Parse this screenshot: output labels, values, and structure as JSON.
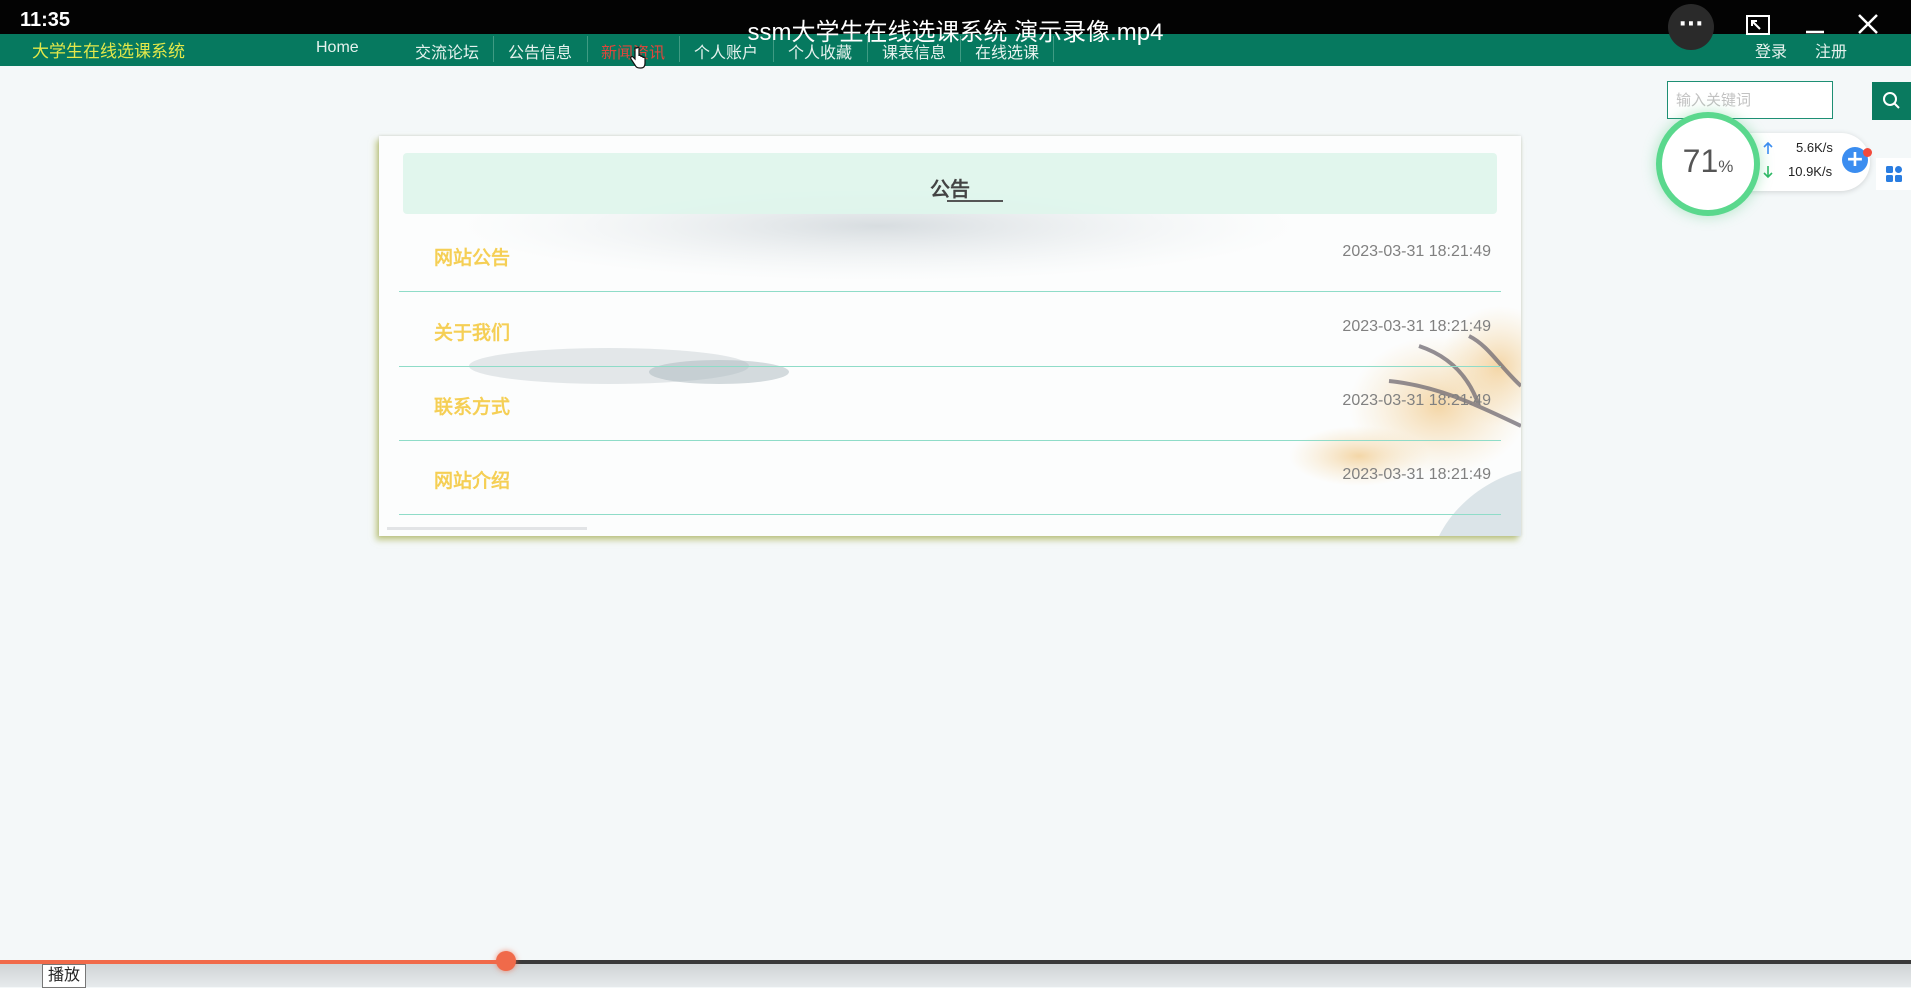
{
  "player": {
    "clock": "11:35",
    "video_title": "ssm大学生在线选课系统 演示录像.mp4",
    "more_label": "···",
    "progress_fraction": 0.265,
    "play_tooltip": "播放"
  },
  "site": {
    "brand": "大学生在线选课系统",
    "nav": [
      {
        "label": "Home"
      },
      {
        "label": "交流论坛"
      },
      {
        "label": "公告信息"
      },
      {
        "label": "新闻资讯"
      },
      {
        "label": "个人账户"
      },
      {
        "label": "个人收藏"
      },
      {
        "label": "课表信息"
      },
      {
        "label": "在线选课"
      }
    ],
    "active_nav": "新闻资讯",
    "login_label": "登录",
    "register_label": "注册",
    "search_placeholder": "输入关键词"
  },
  "speed_widget": {
    "percent": "71",
    "percent_sign": "%",
    "upload": "5.6K/s",
    "download": "10.9K/s"
  },
  "announcements": {
    "title": "公告",
    "items": [
      {
        "title": "网站公告",
        "date": "2023-03-31 18:21:49"
      },
      {
        "title": "关于我们",
        "date": "2023-03-31 18:21:49"
      },
      {
        "title": "联系方式",
        "date": "2023-03-31 18:21:49"
      },
      {
        "title": "网站介绍",
        "date": "2023-03-31 18:21:49"
      }
    ]
  },
  "colors": {
    "nav_bg": "#06795f",
    "brand_text": "#e4e84a",
    "active_nav_text": "#e0463c",
    "row_title_text": "#f5cf55",
    "progress_accent": "#f06a4a"
  }
}
